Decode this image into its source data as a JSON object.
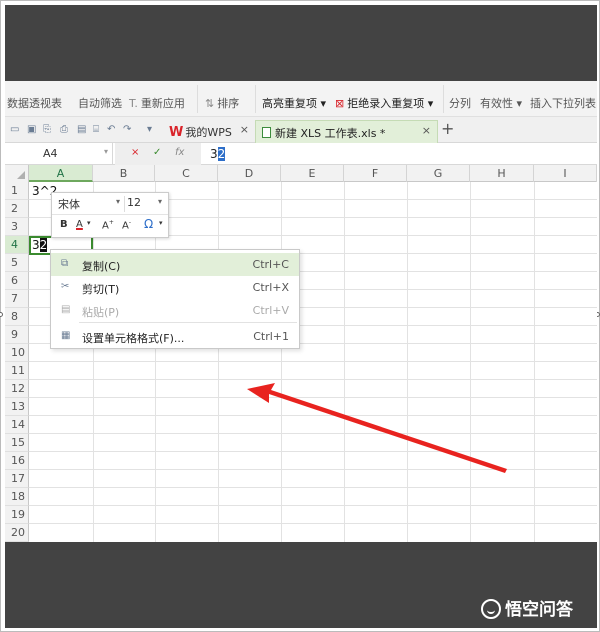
{
  "ribbon": {
    "items": [
      "数据透视表",
      "自动筛选",
      "重新应用",
      "排序",
      "高亮重复项",
      "拒绝录入重复项",
      "分列",
      "有效性",
      "插入下拉列表"
    ],
    "sort_icon": "ĀĪ"
  },
  "tabs": {
    "wps_label": "我的WPS",
    "file_label": "新建 XLS 工作表.xls *",
    "close_glyph": "×",
    "new_tab_glyph": "+"
  },
  "formula_bar": {
    "name_box": "A4",
    "cancel_glyph": "×",
    "confirm_glyph": "✓",
    "fx_label": "fx",
    "content_prefix": "3",
    "content_selected": "2"
  },
  "sheet": {
    "columns": [
      "A",
      "B",
      "C",
      "D",
      "E",
      "F",
      "G",
      "H",
      "I"
    ],
    "rows": [
      "1",
      "2",
      "3",
      "4",
      "5",
      "6",
      "7",
      "8",
      "9",
      "10",
      "11",
      "12",
      "13",
      "14",
      "15",
      "16",
      "17",
      "18",
      "19",
      "20"
    ],
    "cell_a1": "3^2",
    "cell_a4_prefix": "3",
    "cell_a4_selected": "2",
    "active_column": "A",
    "active_row": "4"
  },
  "mini_toolbar": {
    "font": "宋体",
    "size": "12",
    "bold": "B",
    "font_color": "A",
    "grow": "A",
    "shrink": "A",
    "special_char": "Ω"
  },
  "context_menu": {
    "items": [
      {
        "label": "复制(C)",
        "shortcut": "Ctrl+C",
        "icon": "copy-icon"
      },
      {
        "label": "剪切(T)",
        "shortcut": "Ctrl+X",
        "icon": "cut-icon"
      },
      {
        "label": "粘贴(P)",
        "shortcut": "Ctrl+V",
        "icon": "paste-icon"
      },
      {
        "label": "设置单元格格式(F)...",
        "shortcut": "Ctrl+1",
        "icon": "format-cells-icon"
      }
    ]
  },
  "watermark": {
    "text": "悟空问答"
  },
  "colors": {
    "band": "#434343",
    "accent_green": "#3a8a2e",
    "hover_green": "#e2efd9",
    "arrow_red": "#e8231f"
  }
}
